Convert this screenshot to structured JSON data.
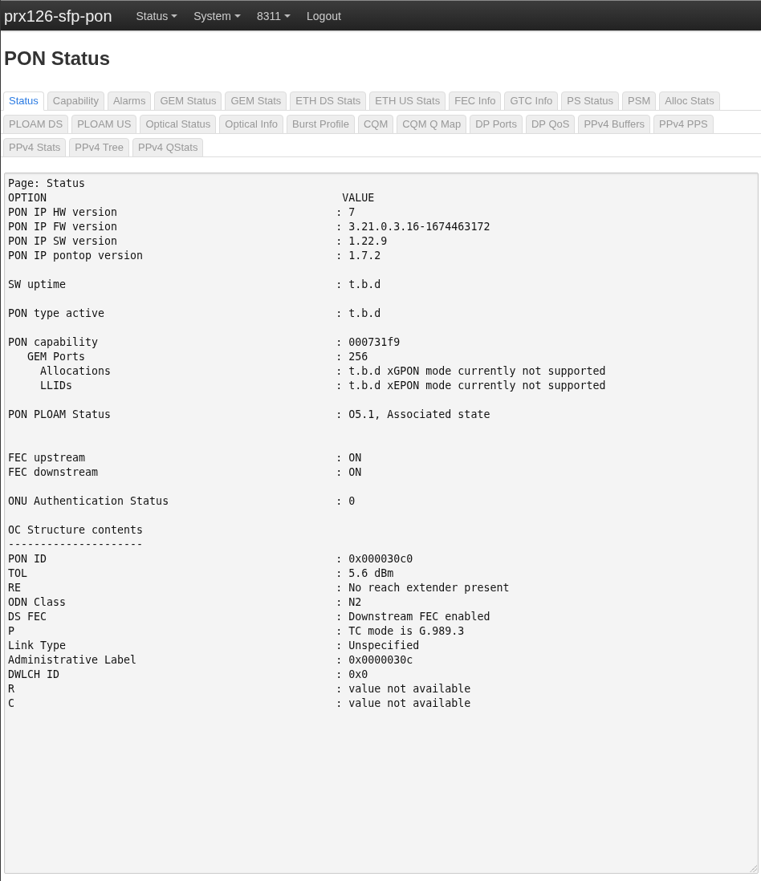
{
  "navbar": {
    "brand": "prx126-sfp-pon",
    "menus": [
      {
        "label": "Status",
        "dropdown": true
      },
      {
        "label": "System",
        "dropdown": true
      },
      {
        "label": "8311",
        "dropdown": true
      },
      {
        "label": "Logout",
        "dropdown": false
      }
    ]
  },
  "page_title": "PON Status",
  "tab_rows": [
    {
      "tabs": [
        {
          "label": "Status",
          "selected": true
        },
        {
          "label": "Capability",
          "selected": false
        },
        {
          "label": "Alarms",
          "selected": false
        },
        {
          "label": "GEM Status",
          "selected": false
        },
        {
          "label": "GEM Stats",
          "selected": false
        },
        {
          "label": "ETH DS Stats",
          "selected": false
        },
        {
          "label": "ETH US Stats",
          "selected": false
        },
        {
          "label": "FEC Info",
          "selected": false
        },
        {
          "label": "GTC Info",
          "selected": false
        },
        {
          "label": "PS Status",
          "selected": false
        },
        {
          "label": "PSM",
          "selected": false
        },
        {
          "label": "Alloc Stats",
          "selected": false
        }
      ]
    },
    {
      "tabs": [
        {
          "label": "PLOAM DS",
          "selected": false
        },
        {
          "label": "PLOAM US",
          "selected": false
        },
        {
          "label": "Optical Status",
          "selected": false
        },
        {
          "label": "Optical Info",
          "selected": false
        },
        {
          "label": "Burst Profile",
          "selected": false
        },
        {
          "label": "CQM",
          "selected": false
        },
        {
          "label": "CQM Q Map",
          "selected": false
        },
        {
          "label": "DP Ports",
          "selected": false
        },
        {
          "label": "DP QoS",
          "selected": false
        },
        {
          "label": "PPv4 Buffers",
          "selected": false
        },
        {
          "label": "PPv4 PPS",
          "selected": false
        }
      ]
    },
    {
      "tabs": [
        {
          "label": "PPv4 Stats",
          "selected": false
        },
        {
          "label": "PPv4 Tree",
          "selected": false
        },
        {
          "label": "PPv4 QStats",
          "selected": false
        }
      ]
    }
  ],
  "output": {
    "lines": [
      {
        "kind": "text",
        "text": "Page: Status"
      },
      {
        "kind": "header",
        "option": "OPTION",
        "value": "VALUE"
      },
      {
        "kind": "entry",
        "option": "PON IP HW version",
        "value": ": 7"
      },
      {
        "kind": "entry",
        "option": "PON IP FW version",
        "value": ": 3.21.0.3.16-1674463172"
      },
      {
        "kind": "entry",
        "option": "PON IP SW version",
        "value": ": 1.22.9"
      },
      {
        "kind": "entry",
        "option": "PON IP pontop version",
        "value": ": 1.7.2"
      },
      {
        "kind": "blank"
      },
      {
        "kind": "entry",
        "option": "SW uptime",
        "value": ": t.b.d"
      },
      {
        "kind": "blank"
      },
      {
        "kind": "entry",
        "option": "PON type active",
        "value": ": t.b.d"
      },
      {
        "kind": "blank"
      },
      {
        "kind": "entry",
        "option": "PON capability",
        "value": ": 000731f9",
        "children": [
          {
            "kind": "entry",
            "option": "GEM Ports",
            "value": ": 256",
            "children": [
              {
                "kind": "entry",
                "option": "Allocations",
                "value": ": t.b.d xGPON mode currently not supported"
              },
              {
                "kind": "entry",
                "option": "LLIDs",
                "value": ": t.b.d xEPON mode currently not supported"
              }
            ]
          }
        ]
      },
      {
        "kind": "blank"
      },
      {
        "kind": "entry",
        "option": "PON PLOAM Status",
        "value": ": O5.1, Associated state"
      },
      {
        "kind": "blank"
      },
      {
        "kind": "blank"
      },
      {
        "kind": "entry",
        "option": "FEC upstream",
        "value": ": ON"
      },
      {
        "kind": "entry",
        "option": "FEC downstream",
        "value": ": ON"
      },
      {
        "kind": "blank"
      },
      {
        "kind": "entry",
        "option": "ONU Authentication Status",
        "value": ": 0"
      },
      {
        "kind": "blank"
      },
      {
        "kind": "heading",
        "text": "OC Structure contents"
      },
      {
        "kind": "rule",
        "text": "---------------------"
      },
      {
        "kind": "entry",
        "option": "PON ID",
        "value": ": 0x000030c0"
      },
      {
        "kind": "entry",
        "option": "TOL",
        "value": ": 5.6 dBm"
      },
      {
        "kind": "entry",
        "option": "RE",
        "value": ": No reach extender present"
      },
      {
        "kind": "entry",
        "option": "ODN Class",
        "value": ": N2"
      },
      {
        "kind": "entry",
        "option": "DS FEC",
        "value": ": Downstream FEC enabled"
      },
      {
        "kind": "entry",
        "option": "P",
        "value": ": TC mode is G.989.3"
      },
      {
        "kind": "entry",
        "option": "Link Type",
        "value": ": Unspecified"
      },
      {
        "kind": "entry",
        "option": "Administrative Label",
        "value": ": 0x0000030c"
      },
      {
        "kind": "entry",
        "option": "DWLCH ID",
        "value": ": 0x0"
      },
      {
        "kind": "entry",
        "option": "R",
        "value": ": value not available"
      },
      {
        "kind": "entry",
        "option": "C",
        "value": ": value not available"
      }
    ]
  }
}
